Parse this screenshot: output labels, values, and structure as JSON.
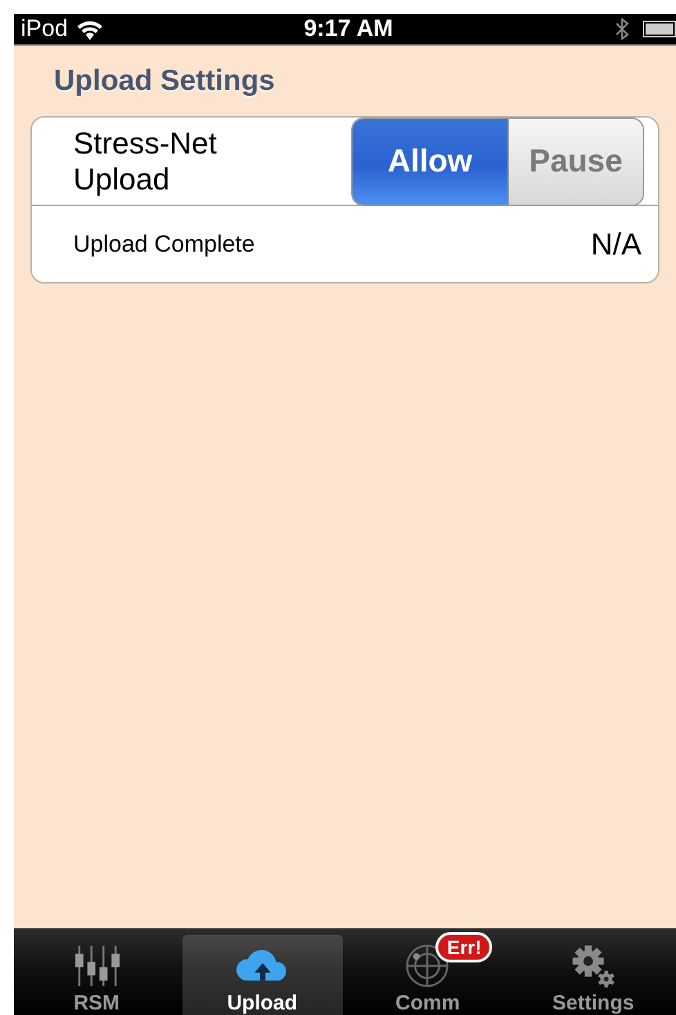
{
  "status_bar": {
    "carrier": "iPod",
    "time": "9:17 AM"
  },
  "section_title": "Upload Settings",
  "settings": [
    {
      "kind": "segmented",
      "label": "Stress-Net Upload",
      "options": [
        {
          "label": "Allow",
          "selected": true
        },
        {
          "label": "Pause",
          "selected": false
        }
      ]
    },
    {
      "kind": "value",
      "label": "Upload Complete",
      "value": "N/A"
    }
  ],
  "tab_bar": [
    {
      "kind": "rsm",
      "label": "RSM",
      "selected": false
    },
    {
      "kind": "upload",
      "label": "Upload",
      "selected": true
    },
    {
      "kind": "comm",
      "label": "Comm",
      "selected": false,
      "badge": "Err!"
    },
    {
      "kind": "settings",
      "label": "Settings",
      "selected": false
    }
  ]
}
